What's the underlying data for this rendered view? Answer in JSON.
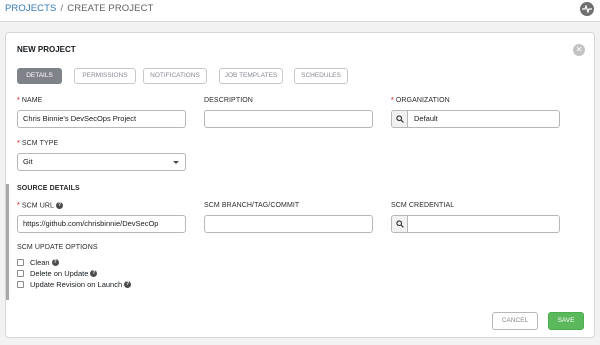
{
  "breadcrumb": {
    "link": "PROJECTS",
    "separator": "/",
    "current": "CREATE PROJECT"
  },
  "icons": {
    "activity": "activity-stream-icon",
    "close": "close-icon",
    "search": "search-icon",
    "help": "question-circle-icon"
  },
  "panel": {
    "title": "NEW PROJECT"
  },
  "tabs": [
    {
      "label": "DETAILS",
      "active": true
    },
    {
      "label": "PERMISSIONS",
      "active": false
    },
    {
      "label": "NOTIFICATIONS",
      "active": false
    },
    {
      "label": "JOB TEMPLATES",
      "active": false
    },
    {
      "label": "SCHEDULES",
      "active": false
    }
  ],
  "fields": {
    "name": {
      "label": "NAME",
      "value": "Chris Binnie's DevSecOps Project",
      "required": true
    },
    "description": {
      "label": "DESCRIPTION",
      "value": ""
    },
    "organization": {
      "label": "ORGANIZATION",
      "value": "Default",
      "required": true
    },
    "scm_type": {
      "label": "SCM TYPE",
      "value": "Git",
      "required": true
    }
  },
  "source_details": {
    "title": "SOURCE DETAILS",
    "scm_url": {
      "label": "SCM URL",
      "value": "https://github.com/chrisbinnie/DevSecOp",
      "required": true
    },
    "scm_branch": {
      "label": "SCM BRANCH/TAG/COMMIT",
      "value": ""
    },
    "scm_credential": {
      "label": "SCM CREDENTIAL",
      "value": ""
    }
  },
  "update_options": {
    "title": "SCM UPDATE OPTIONS",
    "items": [
      {
        "label": "Clean",
        "checked": false
      },
      {
        "label": "Delete on Update",
        "checked": false
      },
      {
        "label": "Update Revision on Launch",
        "checked": false
      }
    ]
  },
  "actions": {
    "cancel": "CANCEL",
    "save": "SAVE"
  },
  "colors": {
    "link": "#337ab7",
    "required": "#d9534f",
    "save": "#5cb85c",
    "active_tab": "#7f8389"
  }
}
